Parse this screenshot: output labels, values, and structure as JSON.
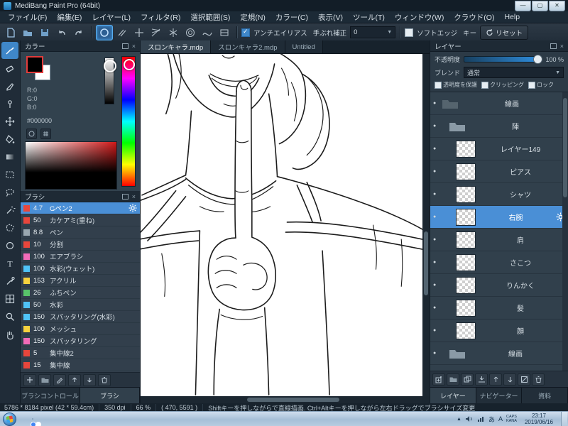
{
  "window": {
    "title": "MediBang Paint Pro (64bit)"
  },
  "menu": {
    "items": [
      "ファイル(F)",
      "編集(E)",
      "レイヤー(L)",
      "フィルタ(R)",
      "選択範囲(S)",
      "定規(N)",
      "カラー(C)",
      "表示(V)",
      "ツール(T)",
      "ウィンドウ(W)",
      "クラウド(O)",
      "Help"
    ]
  },
  "toolbar": {
    "antialias_label": "アンチエイリアス",
    "stabilizer_label": "手ぶれ補正",
    "stabilizer_value": "0",
    "softedge_label": "ソフトエッジ",
    "key_label": "キー",
    "reset_label": "リセット"
  },
  "color_panel": {
    "title": "カラー",
    "r": "R:0",
    "g": "G:0",
    "b": "B:0",
    "hex": "#000000"
  },
  "brush_panel": {
    "title": "ブラシ",
    "brushes": [
      {
        "size": "4.7",
        "name": "Gペン2",
        "color": "#e8463c",
        "selected": true
      },
      {
        "size": "50",
        "name": "カケアミ(重ね)",
        "color": "#e8463c"
      },
      {
        "size": "8.8",
        "name": "ペン",
        "color": "#9aa7b0"
      },
      {
        "size": "10",
        "name": "分割",
        "color": "#e8463c"
      },
      {
        "size": "100",
        "name": "エアブラシ",
        "color": "#f26bb8"
      },
      {
        "size": "100",
        "name": "水彩(ウェット)",
        "color": "#4fc3f7"
      },
      {
        "size": "153",
        "name": "アクリル",
        "color": "#f7d23e"
      },
      {
        "size": "26",
        "name": "ふちペン",
        "color": "#58c46a"
      },
      {
        "size": "50",
        "name": "水彩",
        "color": "#4fc3f7"
      },
      {
        "size": "150",
        "name": "スパッタリング(水彩)",
        "color": "#4fc3f7"
      },
      {
        "size": "100",
        "name": "メッシュ",
        "color": "#f7d23e"
      },
      {
        "size": "150",
        "name": "スパッタリング",
        "color": "#f26bb8"
      },
      {
        "size": "5",
        "name": "集中線2",
        "color": "#e8463c"
      },
      {
        "size": "15",
        "name": "集中線",
        "color": "#e8463c"
      }
    ],
    "tabs": [
      "ブラシコントロール",
      "ブラシ"
    ]
  },
  "canvas": {
    "tabs": [
      "スロンキャラ.mdp",
      "スロンキャラ2.mdp",
      "Untitled"
    ]
  },
  "layers_panel": {
    "title": "レイヤー",
    "opacity_label": "不透明度",
    "opacity_value": "100 %",
    "blend_label": "ブレンド",
    "blend_value": "通常",
    "protect_alpha_label": "透明度を保護",
    "clipping_label": "クリッピング",
    "lock_label": "ロック",
    "layers": [
      {
        "name": "線画",
        "kind": "folder",
        "depth": 0
      },
      {
        "name": "陣",
        "kind": "folder",
        "depth": 1
      },
      {
        "name": "レイヤー149",
        "kind": "layer",
        "depth": 2
      },
      {
        "name": "ピアス",
        "kind": "layer",
        "depth": 2
      },
      {
        "name": "シャツ",
        "kind": "layer",
        "depth": 2
      },
      {
        "name": "右腕",
        "kind": "layer",
        "depth": 2,
        "selected": true
      },
      {
        "name": "肩",
        "kind": "layer",
        "depth": 2
      },
      {
        "name": "さこつ",
        "kind": "layer",
        "depth": 2
      },
      {
        "name": "りんかく",
        "kind": "layer",
        "depth": 2
      },
      {
        "name": "髪",
        "kind": "layer",
        "depth": 2
      },
      {
        "name": "顔",
        "kind": "layer",
        "depth": 2
      },
      {
        "name": "線画",
        "kind": "folder",
        "depth": 1
      }
    ],
    "tabs": [
      "レイヤー",
      "ナビゲーター",
      "資料"
    ]
  },
  "status_bar": {
    "size_info": "5786 * 8184 pixel (42 * 59.4cm)",
    "dpi": "350 dpi",
    "zoom": "66 %",
    "coords": "( 470, 5591 )",
    "hint": "Shiftキーを押しながらで直線描画. Ctrl+Altキーを押しながら左右ドラッグでブラシサイズ変更"
  },
  "taskbar": {
    "ime_a": "あ",
    "ime_mode": "A",
    "caps": "CAPS",
    "kana": "KANA",
    "time": "23:17",
    "date": "2019/06/16"
  }
}
